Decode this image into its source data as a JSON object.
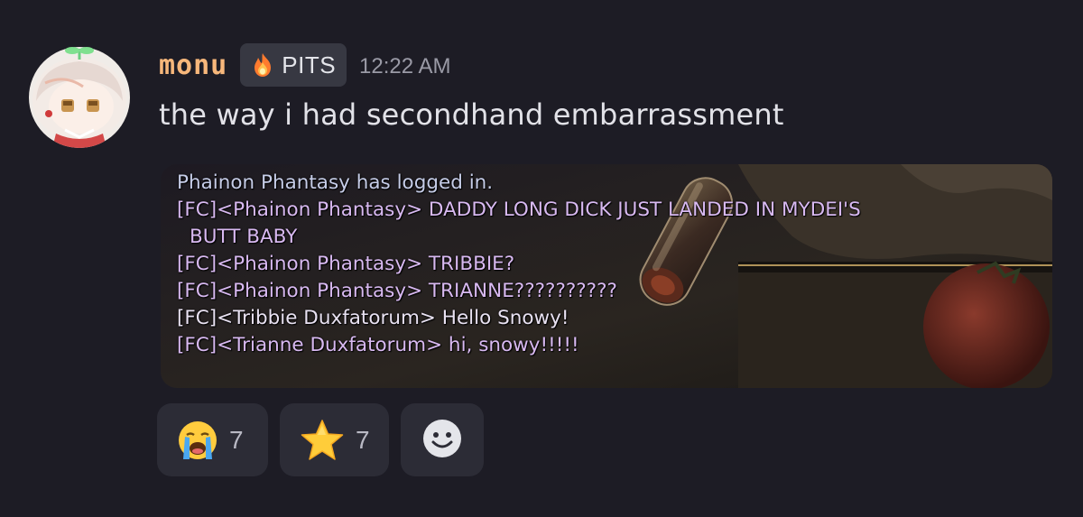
{
  "message": {
    "username": "monu",
    "username_color": "#f7b77b",
    "tag": {
      "label": "PITS",
      "icon": "fire-icon"
    },
    "timestamp": "12:22 AM",
    "text": "the way i had secondhand embarrassment",
    "avatar_icon": "chibi-avatar-icon"
  },
  "attachment": {
    "type": "game-chat-screenshot",
    "lines": [
      {
        "text": "Phainon Phantasy has logged in."
      },
      {
        "text": "[FC]<Phainon Phantasy> DADDY LONG DICK JUST LANDED IN MYDEI'S"
      },
      {
        "text": "BUTT BABY"
      },
      {
        "text": "[FC]<Phainon Phantasy> TRIBBIE?"
      },
      {
        "text": "[FC]<Phainon Phantasy> TRIANNE??????????"
      },
      {
        "text": "[FC]<Tribbie Duxfatorum> Hello Snowy!"
      },
      {
        "text": "[FC]<Trianne Duxfatorum> hi, snowy!!!!!"
      }
    ]
  },
  "reactions": [
    {
      "emoji": "loudly-crying-face-icon",
      "count": "7"
    },
    {
      "emoji": "star-icon",
      "count": "7"
    }
  ],
  "add_reaction": {
    "icon": "smiley-add-reaction-icon"
  },
  "colors": {
    "background": "#1d1c25",
    "chip": "#2c2c36",
    "chat_purple": "#d8b9f1"
  }
}
